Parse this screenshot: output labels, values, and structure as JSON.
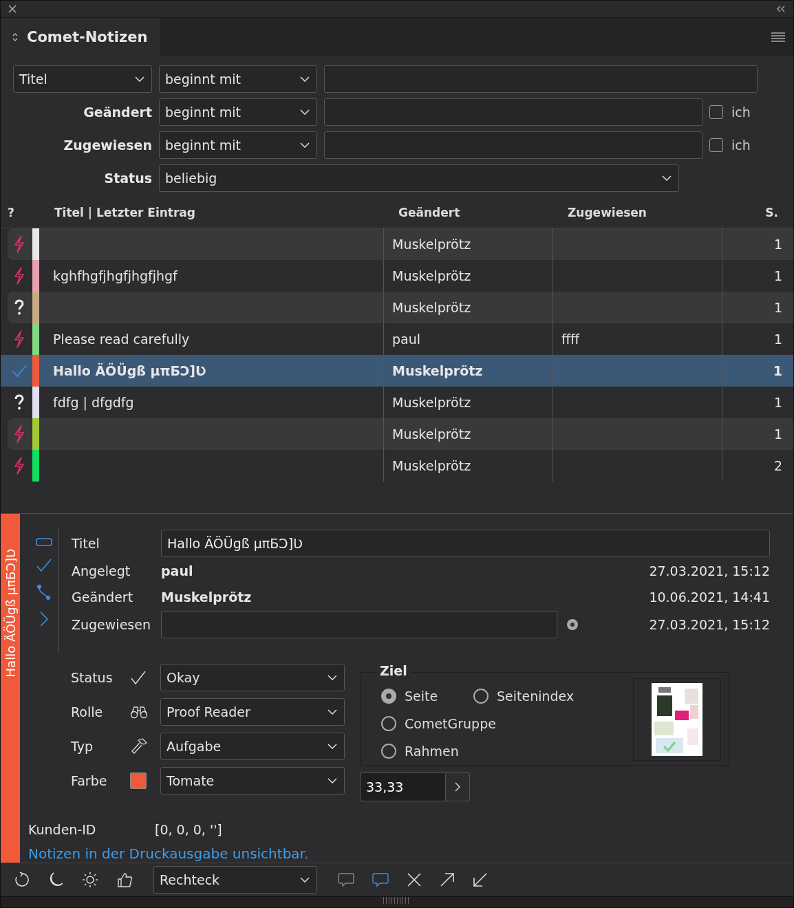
{
  "panel": {
    "title": "Comet-Notizen"
  },
  "filters": {
    "field_select": "Titel",
    "title_op": "beginnt mit",
    "rows": [
      {
        "label": "Geändert",
        "op": "beginnt mit",
        "me_label": "ich",
        "me_checked": false
      },
      {
        "label": "Zugewiesen",
        "op": "beginnt mit",
        "me_label": "ich",
        "me_checked": false
      }
    ],
    "status_label": "Status",
    "status_value": "beliebig"
  },
  "table": {
    "columns": [
      "?",
      "Titel | Letzter Eintrag",
      "Geändert",
      "Zugewiesen",
      "S."
    ],
    "rows": [
      {
        "kind": "urgent",
        "color": "#e8e8e8",
        "title": "",
        "changed": "Muskelprötz",
        "assigned": "",
        "s": "1",
        "selected": false
      },
      {
        "kind": "urgent",
        "color": "#e8a0b0",
        "title": "kghfhgfjhgfjhgfjhgf",
        "changed": "Muskelprötz",
        "assigned": "",
        "s": "1",
        "selected": false
      },
      {
        "kind": "question",
        "color": "#c8ab84",
        "title": "",
        "changed": "Muskelprötz",
        "assigned": "",
        "s": "1",
        "selected": false
      },
      {
        "kind": "urgent",
        "color": "#80d880",
        "title": "Please read carefully",
        "changed": "paul",
        "assigned": "ffff",
        "s": "1",
        "selected": false
      },
      {
        "kind": "done",
        "color": "#f05a3a",
        "title": "Hallo ÄÖÜgß μπБϽ]Ʋ",
        "changed": "Muskelprötz",
        "assigned": "",
        "s": "1",
        "selected": true
      },
      {
        "kind": "question",
        "color": "#e0e0f0",
        "title": "fdfg | dfgdfg",
        "changed": "Muskelprötz",
        "assigned": "",
        "s": "1",
        "selected": false
      },
      {
        "kind": "urgent",
        "color": "#a0c830",
        "title": "",
        "changed": "Muskelprötz",
        "assigned": "",
        "s": "1",
        "selected": false
      },
      {
        "kind": "urgent",
        "color": "#10e060",
        "title": "",
        "changed": "Muskelprötz",
        "assigned": "",
        "s": "2",
        "selected": false
      }
    ]
  },
  "detail": {
    "side_label": "Hallo ÄÖÜgß μπБϽ]Ʋ",
    "color": "#f05a3a",
    "title_label": "Titel",
    "title_value": "Hallo ÄÖÜgß μπБϽ]Ʋ",
    "created_label": "Angelegt",
    "created_by": "paul",
    "created_at": "27.03.2021, 15:12",
    "changed_label": "Geändert",
    "changed_by": "Muskelprötz",
    "changed_at": "10.06.2021, 14:41",
    "assigned_label": "Zugewiesen",
    "assigned_marker_on": true,
    "assigned_at": "27.03.2021, 15:12",
    "selects": [
      {
        "kind": "status",
        "label": "Status",
        "value": "Okay"
      },
      {
        "kind": "role",
        "label": "Rolle",
        "value": "Proof Reader"
      },
      {
        "kind": "type",
        "label": "Typ",
        "value": "Aufgabe"
      },
      {
        "kind": "color",
        "label": "Farbe",
        "value": "Tomate"
      }
    ],
    "target": {
      "legend": "Ziel",
      "options": [
        {
          "label": "Seite",
          "selected": true
        },
        {
          "label": "Seitenindex",
          "selected": false
        },
        {
          "label": "CometGruppe",
          "selected": false
        },
        {
          "label": "Rahmen",
          "selected": false
        }
      ]
    },
    "number": "33,33",
    "customer_label": "Kunden-ID",
    "customer_value": "[0, 0, 0, '']",
    "note": "Notizen in der Druckausgabe unsichtbar."
  },
  "toolbar": {
    "shape": "Rechteck"
  }
}
